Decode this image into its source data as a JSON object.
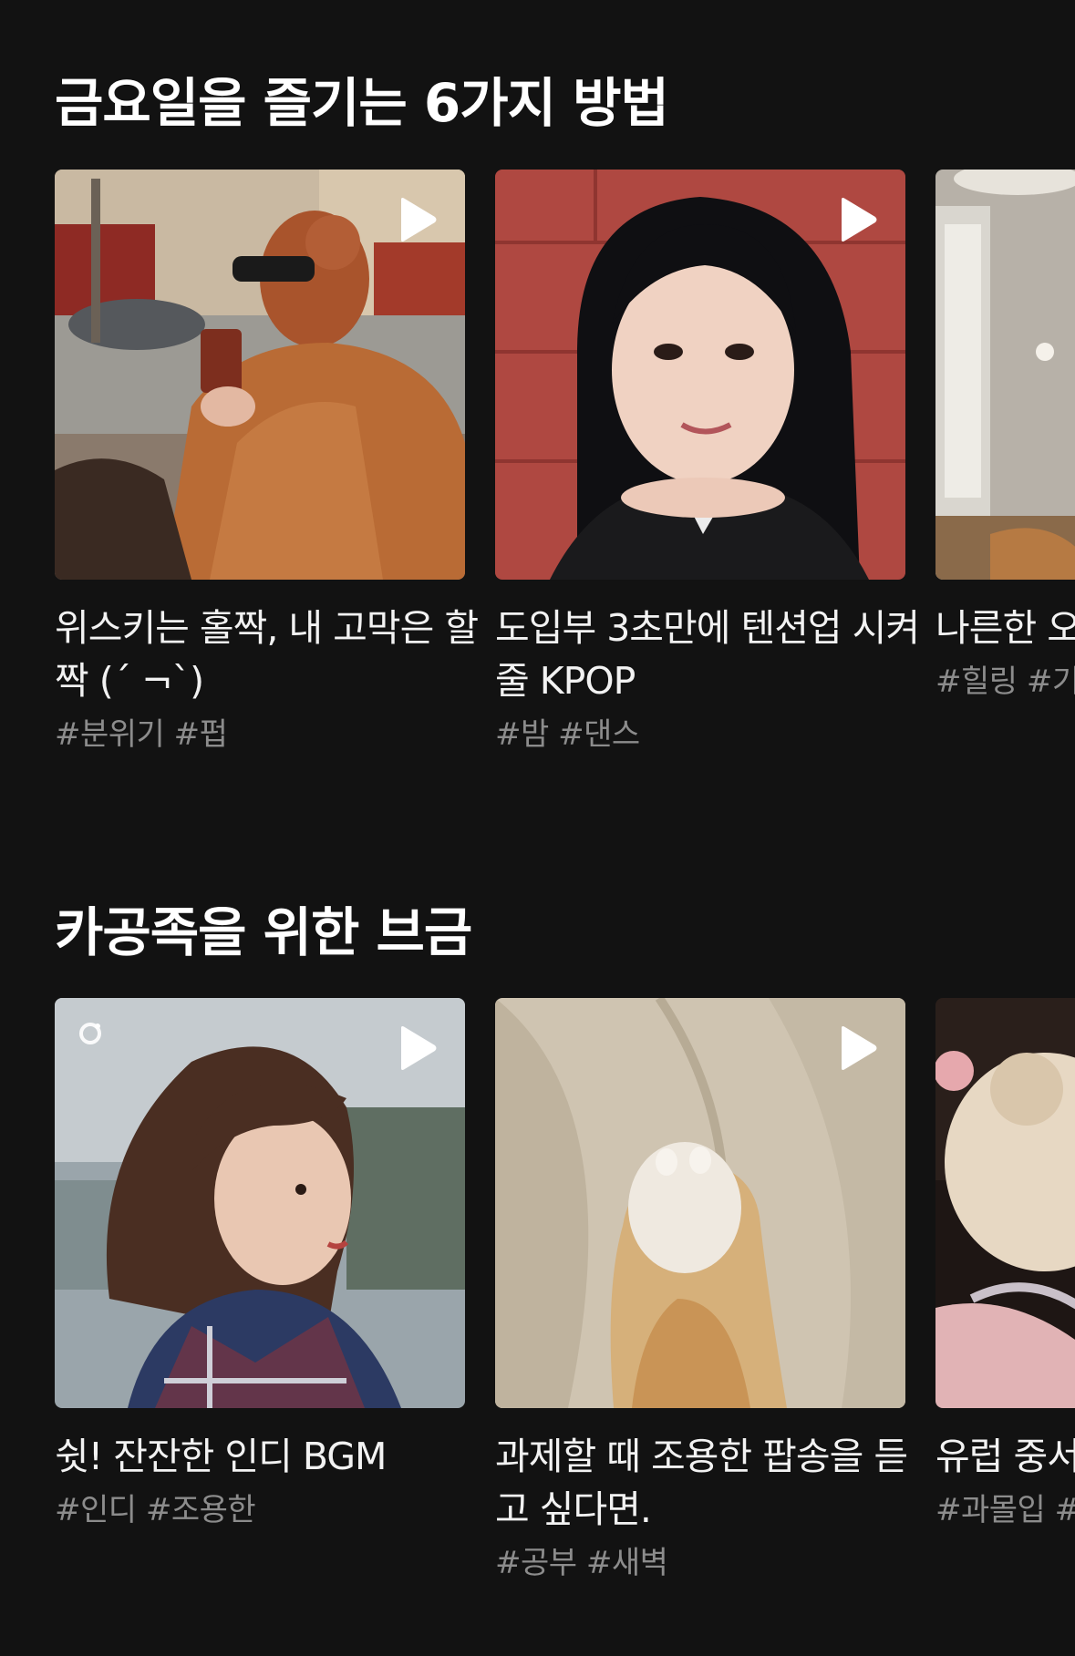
{
  "sections": [
    {
      "title": "금요일을 즐기는 6가지 방법",
      "cards": [
        {
          "title": "위스키는 홀짝, 내 고막은 할짝 (´ ¬`)",
          "tags": "#분위기 #펍",
          "play_icon": "play-icon"
        },
        {
          "title": "도입부 3초만에 텐션업 시켜줄 KPOP",
          "tags": "#밤 #댄스",
          "play_icon": "play-icon"
        },
        {
          "title": "나른한 오 히 UP 시",
          "tags": "#힐링 #기",
          "play_icon": "play-icon"
        }
      ]
    },
    {
      "title": "카공족을 위한 브금",
      "cards": [
        {
          "title": "쉿! 잔잔한 인디 BGM",
          "tags": "#인디 #조용한",
          "play_icon": "play-icon"
        },
        {
          "title": "과제할 때 조용한 팝송을 듣고 싶다면.",
          "tags": "#공부 #새벽",
          "play_icon": "play-icon"
        },
        {
          "title": "유럽 중서 판타지 과",
          "tags": "#과몰입 #",
          "play_icon": "play-icon"
        }
      ]
    }
  ],
  "colors": {
    "background": "#121212",
    "title": "#ffffff",
    "card_title": "#f2f2f2",
    "tags": "#8c8c8c"
  }
}
